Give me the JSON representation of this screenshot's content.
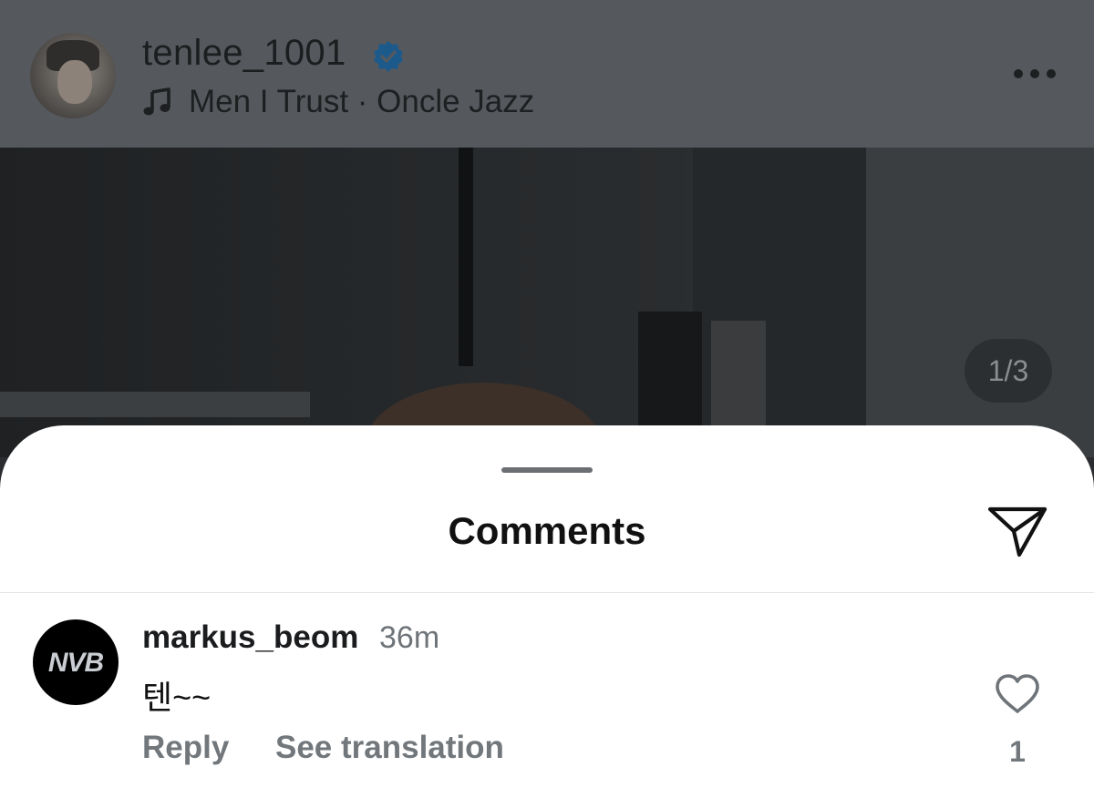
{
  "post": {
    "username": "tenlee_1001",
    "verified": true,
    "music_info": "Men I Trust · Oncle Jazz",
    "page_indicator": "1/3",
    "icons": {
      "verified": "verified-badge-icon",
      "music": "music-note-icon",
      "more": "more-options-icon"
    }
  },
  "comments_sheet": {
    "title": "Comments",
    "share_icon": "send-icon",
    "comments": [
      {
        "username": "markus_beom",
        "time": "36m",
        "text": "텐~~",
        "avatar_text": "NVB",
        "reply_label": "Reply",
        "translate_label": "See translation",
        "like_count": "1",
        "like_icon": "heart-icon"
      }
    ]
  },
  "colors": {
    "verified_blue": "#1d5a8c",
    "overlay_header": "#55595d",
    "secondary_text": "#72777c"
  }
}
